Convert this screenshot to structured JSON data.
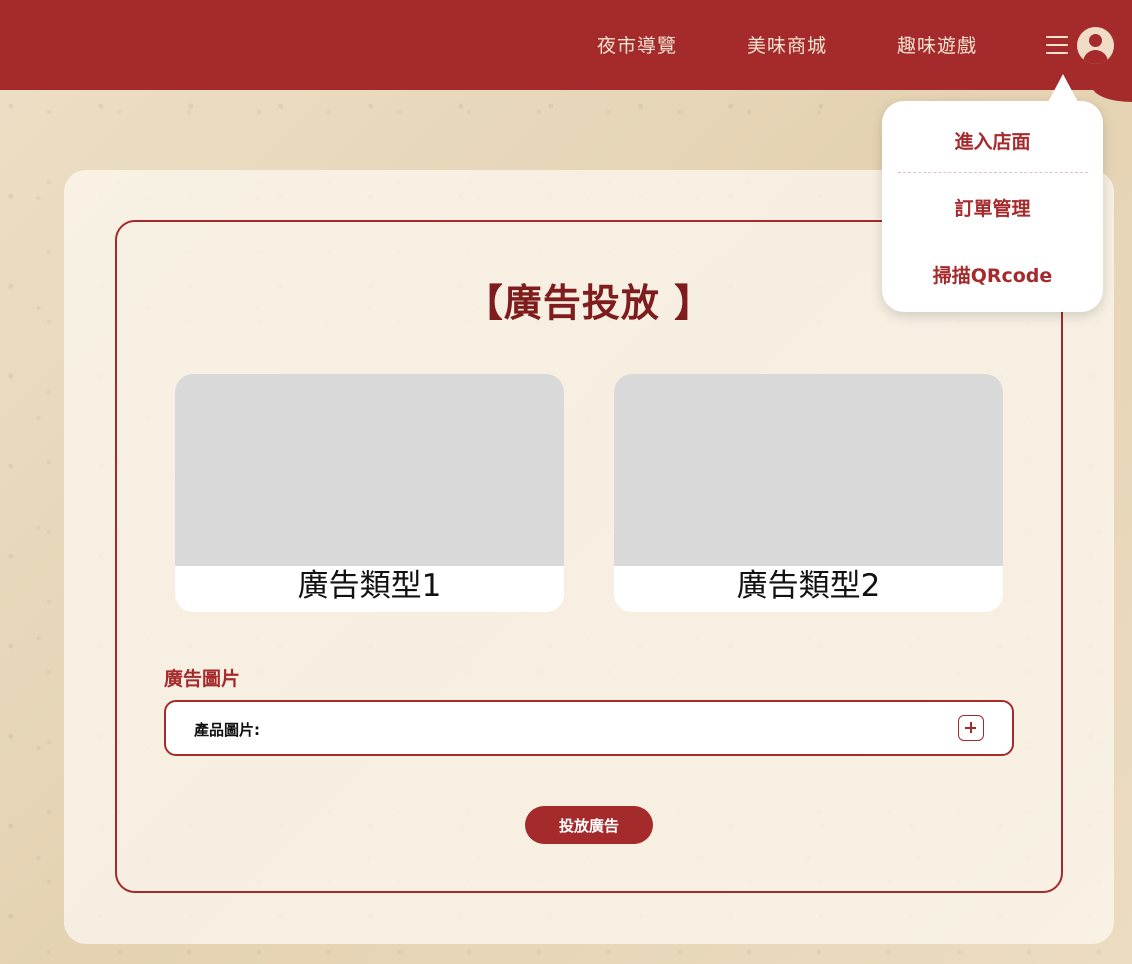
{
  "colors": {
    "brand": "#a52a2c",
    "title": "#7f1d1e",
    "nav_text": "#f3e3cf",
    "placeholder": "#d9d9d9"
  },
  "header": {
    "nav": [
      {
        "label": "夜市導覽"
      },
      {
        "label": "美味商城"
      },
      {
        "label": "趣味遊戲"
      }
    ],
    "menu_icon": "hamburger-icon",
    "avatar_icon": "user-avatar-icon"
  },
  "dropdown": {
    "items": [
      {
        "label": "進入店面"
      },
      {
        "label": "訂單管理"
      },
      {
        "label": "掃描QRcode"
      }
    ]
  },
  "main": {
    "title": "【廣告投放 】",
    "ad_types": [
      {
        "label": "廣告類型1"
      },
      {
        "label": "廣告類型2"
      }
    ],
    "image_section": {
      "label": "廣告圖片",
      "field_label": "產品圖片:",
      "add_icon": "plus-icon"
    },
    "submit_label": "投放廣告"
  }
}
